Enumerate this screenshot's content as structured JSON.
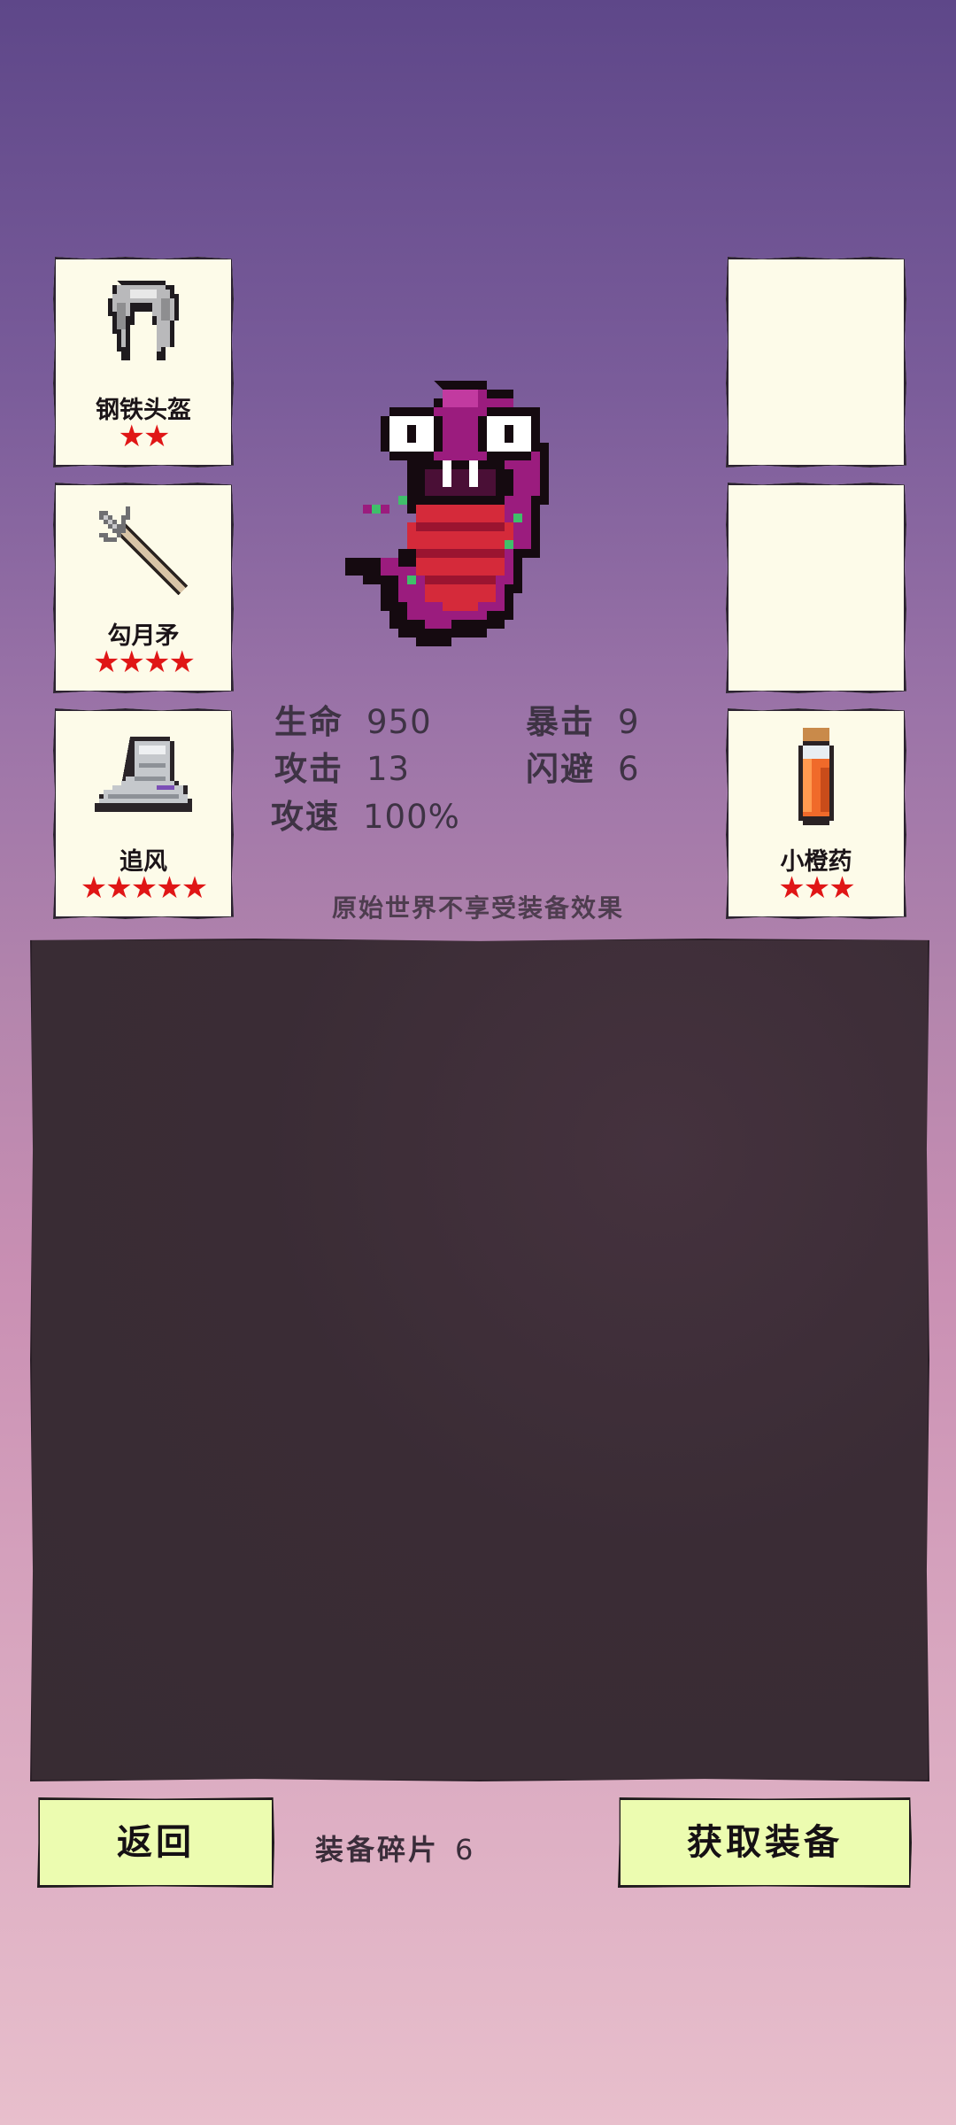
{
  "equipment_left": [
    {
      "name": "钢铁头盔",
      "stars": "★★",
      "icon": "helmet-icon"
    },
    {
      "name": "勾月矛",
      "stars": "★★★★",
      "icon": "spear-icon"
    },
    {
      "name": "追风",
      "stars": "★★★★★",
      "icon": "boots-icon"
    }
  ],
  "equipment_right": [
    {
      "name": "",
      "stars": "",
      "icon": ""
    },
    {
      "name": "",
      "stars": "",
      "icon": ""
    },
    {
      "name": "小橙药",
      "stars": "★★★",
      "icon": "potion-icon"
    }
  ],
  "character": {
    "icon": "serpent-monster-sprite"
  },
  "stats": {
    "hp": {
      "label": "生命",
      "value": "950"
    },
    "crit": {
      "label": "暴击",
      "value": "9"
    },
    "atk": {
      "label": "攻击",
      "value": "13"
    },
    "dodge": {
      "label": "闪避",
      "value": "6"
    },
    "speed": {
      "label": "攻速",
      "value": "100%"
    }
  },
  "note": "原始世界不享受装备效果",
  "footer": {
    "back_label": "返回",
    "fragments_label": "装备碎片",
    "fragments_value": "6",
    "get_label": "获取装备"
  },
  "colors": {
    "star": "#e01616",
    "button": "#ecfcb0",
    "panel": "#382c33"
  }
}
